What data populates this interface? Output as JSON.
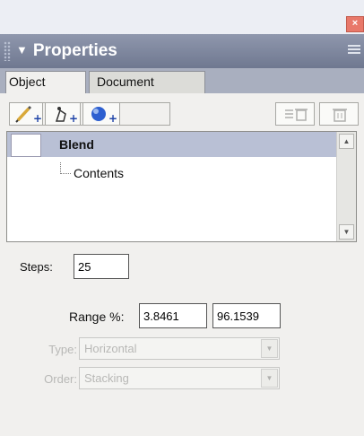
{
  "panel": {
    "title": "Properties",
    "close_glyph": "×",
    "title_arrow": "▼"
  },
  "tabs": [
    {
      "label": "Object",
      "active": true
    },
    {
      "label": "Document",
      "active": false
    }
  ],
  "toolbar": {
    "buttons": [
      "pencil-add-icon",
      "paint-drop-add-icon",
      "sphere-add-icon",
      "trash-icon",
      "delete-icon"
    ]
  },
  "layers": {
    "items": [
      {
        "label": "Blend",
        "selected": true
      },
      {
        "label": "Contents",
        "selected": false
      }
    ],
    "scroll_up": "▲",
    "scroll_down": "▼"
  },
  "blend": {
    "steps_label": "Steps:",
    "steps_value": "25",
    "range_label": "Range %:",
    "range_min": "3.8461",
    "range_max": "96.1539",
    "type_label": "Type:",
    "type_value": "Horizontal",
    "order_label": "Order:",
    "order_value": "Stacking",
    "dropdown_glyph": "▼"
  },
  "colors": {
    "titlebar": "#7f879d",
    "tab_strip": "#a9afbf",
    "selection": "#b9c0d5",
    "close_button": "#e8786a"
  }
}
